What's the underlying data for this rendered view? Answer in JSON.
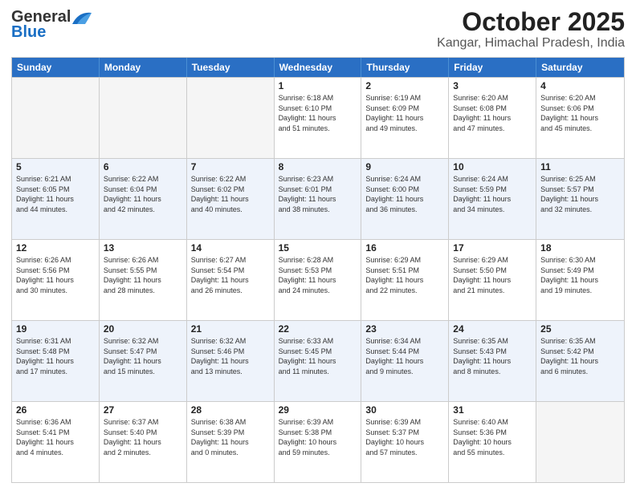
{
  "header": {
    "logo_general": "General",
    "logo_blue": "Blue",
    "title": "October 2025",
    "subtitle": "Kangar, Himachal Pradesh, India"
  },
  "days_of_week": [
    "Sunday",
    "Monday",
    "Tuesday",
    "Wednesday",
    "Thursday",
    "Friday",
    "Saturday"
  ],
  "rows": [
    [
      {
        "day": "",
        "info": ""
      },
      {
        "day": "",
        "info": ""
      },
      {
        "day": "",
        "info": ""
      },
      {
        "day": "1",
        "info": "Sunrise: 6:18 AM\nSunset: 6:10 PM\nDaylight: 11 hours\nand 51 minutes."
      },
      {
        "day": "2",
        "info": "Sunrise: 6:19 AM\nSunset: 6:09 PM\nDaylight: 11 hours\nand 49 minutes."
      },
      {
        "day": "3",
        "info": "Sunrise: 6:20 AM\nSunset: 6:08 PM\nDaylight: 11 hours\nand 47 minutes."
      },
      {
        "day": "4",
        "info": "Sunrise: 6:20 AM\nSunset: 6:06 PM\nDaylight: 11 hours\nand 45 minutes."
      }
    ],
    [
      {
        "day": "5",
        "info": "Sunrise: 6:21 AM\nSunset: 6:05 PM\nDaylight: 11 hours\nand 44 minutes."
      },
      {
        "day": "6",
        "info": "Sunrise: 6:22 AM\nSunset: 6:04 PM\nDaylight: 11 hours\nand 42 minutes."
      },
      {
        "day": "7",
        "info": "Sunrise: 6:22 AM\nSunset: 6:02 PM\nDaylight: 11 hours\nand 40 minutes."
      },
      {
        "day": "8",
        "info": "Sunrise: 6:23 AM\nSunset: 6:01 PM\nDaylight: 11 hours\nand 38 minutes."
      },
      {
        "day": "9",
        "info": "Sunrise: 6:24 AM\nSunset: 6:00 PM\nDaylight: 11 hours\nand 36 minutes."
      },
      {
        "day": "10",
        "info": "Sunrise: 6:24 AM\nSunset: 5:59 PM\nDaylight: 11 hours\nand 34 minutes."
      },
      {
        "day": "11",
        "info": "Sunrise: 6:25 AM\nSunset: 5:57 PM\nDaylight: 11 hours\nand 32 minutes."
      }
    ],
    [
      {
        "day": "12",
        "info": "Sunrise: 6:26 AM\nSunset: 5:56 PM\nDaylight: 11 hours\nand 30 minutes."
      },
      {
        "day": "13",
        "info": "Sunrise: 6:26 AM\nSunset: 5:55 PM\nDaylight: 11 hours\nand 28 minutes."
      },
      {
        "day": "14",
        "info": "Sunrise: 6:27 AM\nSunset: 5:54 PM\nDaylight: 11 hours\nand 26 minutes."
      },
      {
        "day": "15",
        "info": "Sunrise: 6:28 AM\nSunset: 5:53 PM\nDaylight: 11 hours\nand 24 minutes."
      },
      {
        "day": "16",
        "info": "Sunrise: 6:29 AM\nSunset: 5:51 PM\nDaylight: 11 hours\nand 22 minutes."
      },
      {
        "day": "17",
        "info": "Sunrise: 6:29 AM\nSunset: 5:50 PM\nDaylight: 11 hours\nand 21 minutes."
      },
      {
        "day": "18",
        "info": "Sunrise: 6:30 AM\nSunset: 5:49 PM\nDaylight: 11 hours\nand 19 minutes."
      }
    ],
    [
      {
        "day": "19",
        "info": "Sunrise: 6:31 AM\nSunset: 5:48 PM\nDaylight: 11 hours\nand 17 minutes."
      },
      {
        "day": "20",
        "info": "Sunrise: 6:32 AM\nSunset: 5:47 PM\nDaylight: 11 hours\nand 15 minutes."
      },
      {
        "day": "21",
        "info": "Sunrise: 6:32 AM\nSunset: 5:46 PM\nDaylight: 11 hours\nand 13 minutes."
      },
      {
        "day": "22",
        "info": "Sunrise: 6:33 AM\nSunset: 5:45 PM\nDaylight: 11 hours\nand 11 minutes."
      },
      {
        "day": "23",
        "info": "Sunrise: 6:34 AM\nSunset: 5:44 PM\nDaylight: 11 hours\nand 9 minutes."
      },
      {
        "day": "24",
        "info": "Sunrise: 6:35 AM\nSunset: 5:43 PM\nDaylight: 11 hours\nand 8 minutes."
      },
      {
        "day": "25",
        "info": "Sunrise: 6:35 AM\nSunset: 5:42 PM\nDaylight: 11 hours\nand 6 minutes."
      }
    ],
    [
      {
        "day": "26",
        "info": "Sunrise: 6:36 AM\nSunset: 5:41 PM\nDaylight: 11 hours\nand 4 minutes."
      },
      {
        "day": "27",
        "info": "Sunrise: 6:37 AM\nSunset: 5:40 PM\nDaylight: 11 hours\nand 2 minutes."
      },
      {
        "day": "28",
        "info": "Sunrise: 6:38 AM\nSunset: 5:39 PM\nDaylight: 11 hours\nand 0 minutes."
      },
      {
        "day": "29",
        "info": "Sunrise: 6:39 AM\nSunset: 5:38 PM\nDaylight: 10 hours\nand 59 minutes."
      },
      {
        "day": "30",
        "info": "Sunrise: 6:39 AM\nSunset: 5:37 PM\nDaylight: 10 hours\nand 57 minutes."
      },
      {
        "day": "31",
        "info": "Sunrise: 6:40 AM\nSunset: 5:36 PM\nDaylight: 10 hours\nand 55 minutes."
      },
      {
        "day": "",
        "info": ""
      }
    ]
  ]
}
